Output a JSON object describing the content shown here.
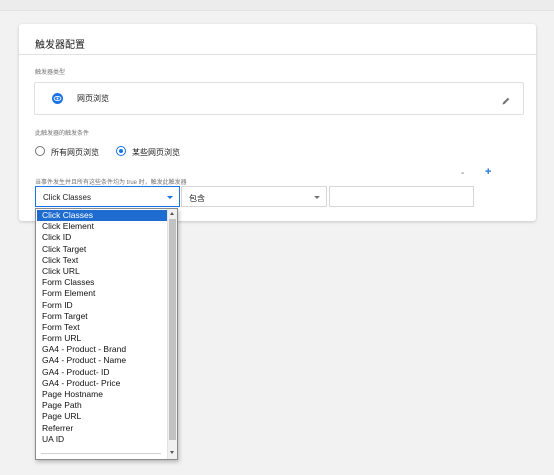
{
  "card": {
    "title": "触发器配置",
    "type_label": "触发器类型",
    "type_name": "网页浏览",
    "condition_label": "此触发器的触发条件",
    "radio_all": "所有网页浏览",
    "radio_some": "某些网页浏览",
    "rule_label": "当事件发生并且所有这些条件均为 true 时，触发此触发器"
  },
  "condition_row": {
    "variable_value": "Click Classes",
    "operator_value": "包含",
    "value_input": "",
    "minus_label": "-",
    "plus_label": "+"
  },
  "dropdown": {
    "items": [
      "Click Classes",
      "Click Element",
      "Click ID",
      "Click Target",
      "Click Text",
      "Click URL",
      "Form Classes",
      "Form Element",
      "Form ID",
      "Form Target",
      "Form Text",
      "Form URL",
      "GA4 - Product - Brand",
      "GA4 - Product - Name",
      "GA4 - Product- ID",
      "GA4 - Product- Price",
      "Page Hostname",
      "Page Path",
      "Page URL",
      "Referrer",
      "UA ID"
    ],
    "selected_index": 0
  },
  "colors": {
    "accent": "#1a73e8",
    "selection": "#1e6ccf",
    "background": "#f2f2f2"
  },
  "icons": [
    "eye-icon",
    "pencil-icon",
    "chevron-down-icon"
  ]
}
